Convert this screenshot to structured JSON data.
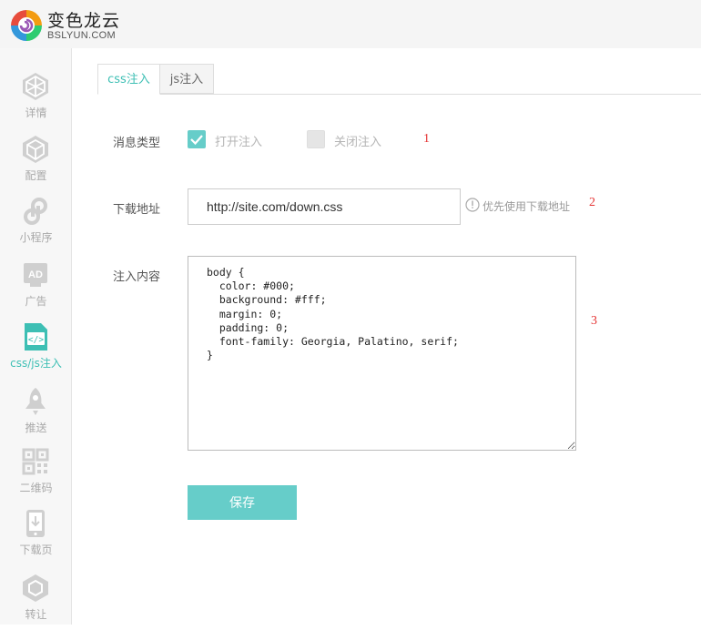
{
  "brand": {
    "name": "变色龙云",
    "sub": "BSLYUN.COM"
  },
  "sidebar": {
    "items": [
      {
        "label": "详情",
        "icon": "cube-outline-icon"
      },
      {
        "label": "配置",
        "icon": "cube-solid-icon"
      },
      {
        "label": "小程序",
        "icon": "miniprogram-icon"
      },
      {
        "label": "广告",
        "icon": "ad-icon"
      },
      {
        "label": "css/js注入",
        "icon": "code-file-icon",
        "active": true
      },
      {
        "label": "推送",
        "icon": "rocket-icon"
      },
      {
        "label": "二维码",
        "icon": "qrcode-icon"
      },
      {
        "label": "下载页",
        "icon": "phone-download-icon"
      },
      {
        "label": "转让",
        "icon": "transfer-hex-icon"
      }
    ]
  },
  "tabs": [
    {
      "label": "css注入",
      "active": true
    },
    {
      "label": "js注入",
      "active": false
    }
  ],
  "form": {
    "type_label": "消息类型",
    "option_on": "打开注入",
    "option_off": "关闭注入",
    "url_label": "下载地址",
    "url_value": "http://site.com/down.css",
    "url_hint": "优先使用下载地址",
    "content_label": "注入内容",
    "content_value": "body {\n  color: #000;\n  background: #fff;\n  margin: 0;\n  padding: 0;\n  font-family: Georgia, Palatino, serif;\n}",
    "save_label": "保存"
  },
  "annotations": [
    "1",
    "2",
    "3"
  ],
  "colors": {
    "accent": "#3dbfb4",
    "button": "#66cdc9",
    "annotation": "#e53333"
  }
}
